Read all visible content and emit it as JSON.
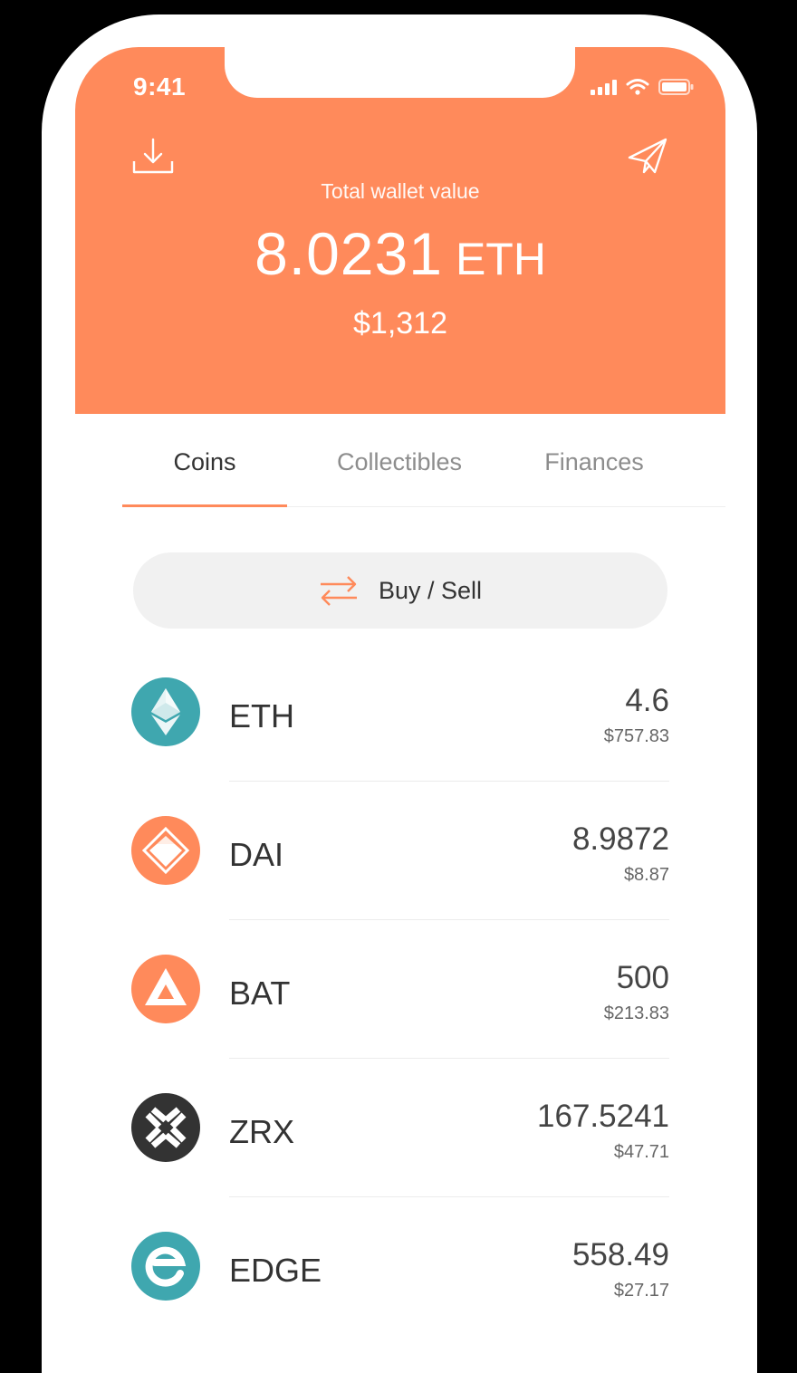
{
  "status_bar": {
    "time": "9:41"
  },
  "header": {
    "label": "Total wallet value",
    "value": "8.0231",
    "unit": "ETH",
    "fiat": "$1,312",
    "receive_icon": "download-icon",
    "send_icon": "paper-plane-icon"
  },
  "tabs": [
    {
      "label": "Coins",
      "active": true
    },
    {
      "label": "Collectibles",
      "active": false
    },
    {
      "label": "Finances",
      "active": false
    }
  ],
  "buy_sell": {
    "label": "Buy / Sell",
    "icon": "swap-arrows-icon"
  },
  "coins": [
    {
      "symbol": "ETH",
      "amount": "4.6",
      "fiat": "$757.83",
      "color": "#3FA7AF"
    },
    {
      "symbol": "DAI",
      "amount": "8.9872",
      "fiat": "$8.87",
      "color": "#FF8A5B"
    },
    {
      "symbol": "BAT",
      "amount": "500",
      "fiat": "$213.83",
      "color": "#FF8A5B"
    },
    {
      "symbol": "ZRX",
      "amount": "167.5241",
      "fiat": "$47.71",
      "color": "#333333"
    },
    {
      "symbol": "EDGE",
      "amount": "558.49",
      "fiat": "$27.17",
      "color": "#3FA7AF"
    }
  ],
  "colors": {
    "accent": "#FF8A5B",
    "teal": "#3FA7AF"
  }
}
